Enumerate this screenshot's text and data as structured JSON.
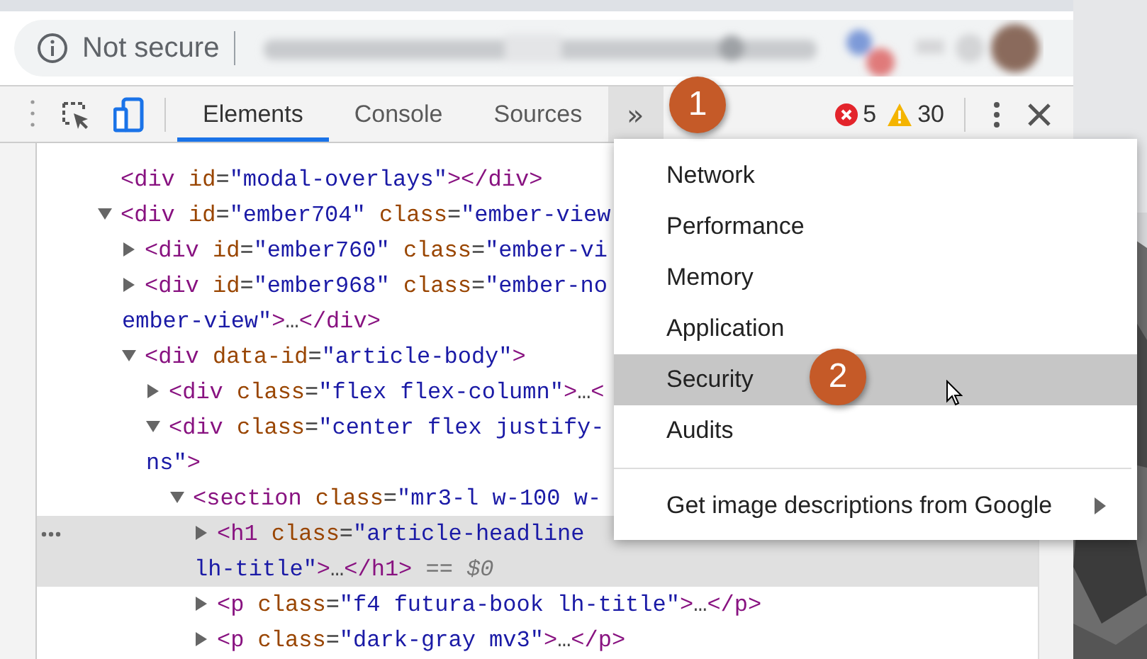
{
  "address_bar": {
    "security_label": "Not secure"
  },
  "devtools": {
    "tabs": [
      {
        "label": "Elements",
        "selected": true
      },
      {
        "label": "Console",
        "selected": false
      },
      {
        "label": "Sources",
        "selected": false
      }
    ],
    "more_tabs": "»",
    "error_count": "5",
    "warning_count": "30"
  },
  "elements_tree": [
    {
      "lines": [
        [
          {
            "kind": "tag",
            "text": "<div"
          },
          {
            "kind": "attr",
            "text": " id"
          },
          {
            "kind": "plain",
            "text": "="
          },
          {
            "kind": "val",
            "text": "\"modal-overlays\""
          },
          {
            "kind": "tag",
            "text": "></div>"
          }
        ]
      ]
    },
    {
      "expanded": true,
      "lines": [
        [
          {
            "kind": "tag",
            "text": "<div"
          },
          {
            "kind": "attr",
            "text": " id"
          },
          {
            "kind": "plain",
            "text": "="
          },
          {
            "kind": "val",
            "text": "\"ember704\""
          },
          {
            "kind": "attr",
            "text": " class"
          },
          {
            "kind": "plain",
            "text": "="
          },
          {
            "kind": "val",
            "text": "\"ember-view"
          }
        ]
      ],
      "children": [
        {
          "expanded": false,
          "lines": [
            [
              {
                "kind": "tag",
                "text": "<div"
              },
              {
                "kind": "attr",
                "text": " id"
              },
              {
                "kind": "plain",
                "text": "="
              },
              {
                "kind": "val",
                "text": "\"ember760\""
              },
              {
                "kind": "attr",
                "text": " class"
              },
              {
                "kind": "plain",
                "text": "="
              },
              {
                "kind": "val",
                "text": "\"ember-vi"
              }
            ]
          ]
        },
        {
          "expanded": false,
          "lines": [
            [
              {
                "kind": "tag",
                "text": "<div"
              },
              {
                "kind": "attr",
                "text": " id"
              },
              {
                "kind": "plain",
                "text": "="
              },
              {
                "kind": "val",
                "text": "\"ember968\""
              },
              {
                "kind": "attr",
                "text": " class"
              },
              {
                "kind": "plain",
                "text": "="
              },
              {
                "kind": "val",
                "text": "\"ember-no"
              }
            ],
            [
              {
                "kind": "val",
                "text": "ember-view\""
              },
              {
                "kind": "tag",
                "text": ">"
              },
              {
                "kind": "plain",
                "text": "…"
              },
              {
                "kind": "tag",
                "text": "</div>"
              }
            ]
          ]
        },
        {
          "expanded": true,
          "lines": [
            [
              {
                "kind": "tag",
                "text": "<div"
              },
              {
                "kind": "attr",
                "text": " data-id"
              },
              {
                "kind": "plain",
                "text": "="
              },
              {
                "kind": "val",
                "text": "\"article-body\""
              },
              {
                "kind": "tag",
                "text": ">"
              }
            ]
          ],
          "children": [
            {
              "expanded": false,
              "lines": [
                [
                  {
                    "kind": "tag",
                    "text": "<div"
                  },
                  {
                    "kind": "attr",
                    "text": " class"
                  },
                  {
                    "kind": "plain",
                    "text": "="
                  },
                  {
                    "kind": "val",
                    "text": "\"flex flex-column\""
                  },
                  {
                    "kind": "tag",
                    "text": ">"
                  },
                  {
                    "kind": "plain",
                    "text": "…"
                  },
                  {
                    "kind": "tag",
                    "text": "<"
                  }
                ]
              ]
            },
            {
              "expanded": true,
              "lines": [
                [
                  {
                    "kind": "tag",
                    "text": "<div"
                  },
                  {
                    "kind": "attr",
                    "text": " class"
                  },
                  {
                    "kind": "plain",
                    "text": "="
                  },
                  {
                    "kind": "val",
                    "text": "\"center flex justify-"
                  }
                ],
                [
                  {
                    "kind": "val",
                    "text": "ns\""
                  },
                  {
                    "kind": "tag",
                    "text": ">"
                  }
                ]
              ],
              "children": [
                {
                  "expanded": true,
                  "lines": [
                    [
                      {
                        "kind": "tag",
                        "text": "<section"
                      },
                      {
                        "kind": "attr",
                        "text": " class"
                      },
                      {
                        "kind": "plain",
                        "text": "="
                      },
                      {
                        "kind": "val",
                        "text": "\"mr3-l w-100 w-"
                      }
                    ]
                  ],
                  "children": [
                    {
                      "expanded": false,
                      "selected": true,
                      "lines": [
                        [
                          {
                            "kind": "tag",
                            "text": "<h1"
                          },
                          {
                            "kind": "attr",
                            "text": " class"
                          },
                          {
                            "kind": "plain",
                            "text": "="
                          },
                          {
                            "kind": "val",
                            "text": "\"article-headline"
                          }
                        ],
                        [
                          {
                            "kind": "val",
                            "text": "lh-title\""
                          },
                          {
                            "kind": "tag",
                            "text": ">"
                          },
                          {
                            "kind": "plain",
                            "text": "…"
                          },
                          {
                            "kind": "tag",
                            "text": "</h1>"
                          },
                          {
                            "kind": "note",
                            "text": " == $0"
                          }
                        ]
                      ]
                    },
                    {
                      "expanded": false,
                      "selected": false,
                      "lines": [
                        [
                          {
                            "kind": "tag",
                            "text": "<p"
                          },
                          {
                            "kind": "attr",
                            "text": " class"
                          },
                          {
                            "kind": "plain",
                            "text": "="
                          },
                          {
                            "kind": "val",
                            "text": "\"f4 futura-book lh-title\""
                          },
                          {
                            "kind": "tag",
                            "text": ">"
                          },
                          {
                            "kind": "plain",
                            "text": "…"
                          },
                          {
                            "kind": "tag",
                            "text": "</p>"
                          }
                        ]
                      ]
                    },
                    {
                      "expanded": false,
                      "selected": false,
                      "lines": [
                        [
                          {
                            "kind": "tag",
                            "text": "<p"
                          },
                          {
                            "kind": "attr",
                            "text": " class"
                          },
                          {
                            "kind": "plain",
                            "text": "="
                          },
                          {
                            "kind": "val",
                            "text": "\"dark-gray mv3\""
                          },
                          {
                            "kind": "tag",
                            "text": ">"
                          },
                          {
                            "kind": "plain",
                            "text": "…"
                          },
                          {
                            "kind": "tag",
                            "text": "</p>"
                          }
                        ]
                      ]
                    }
                  ]
                }
              ]
            }
          ]
        }
      ]
    }
  ],
  "more_menu": [
    {
      "kind": "item",
      "label": "Network",
      "selected": false
    },
    {
      "kind": "item",
      "label": "Performance",
      "selected": false
    },
    {
      "kind": "item",
      "label": "Memory",
      "selected": false
    },
    {
      "kind": "item",
      "label": "Application",
      "selected": false
    },
    {
      "kind": "item",
      "label": "Security",
      "selected": true
    },
    {
      "kind": "item",
      "label": "Audits",
      "selected": false
    },
    {
      "kind": "separator"
    },
    {
      "kind": "submenu",
      "label": "Get image descriptions from Google",
      "selected": false
    }
  ],
  "callouts": [
    {
      "label": "1"
    },
    {
      "label": "2"
    }
  ]
}
